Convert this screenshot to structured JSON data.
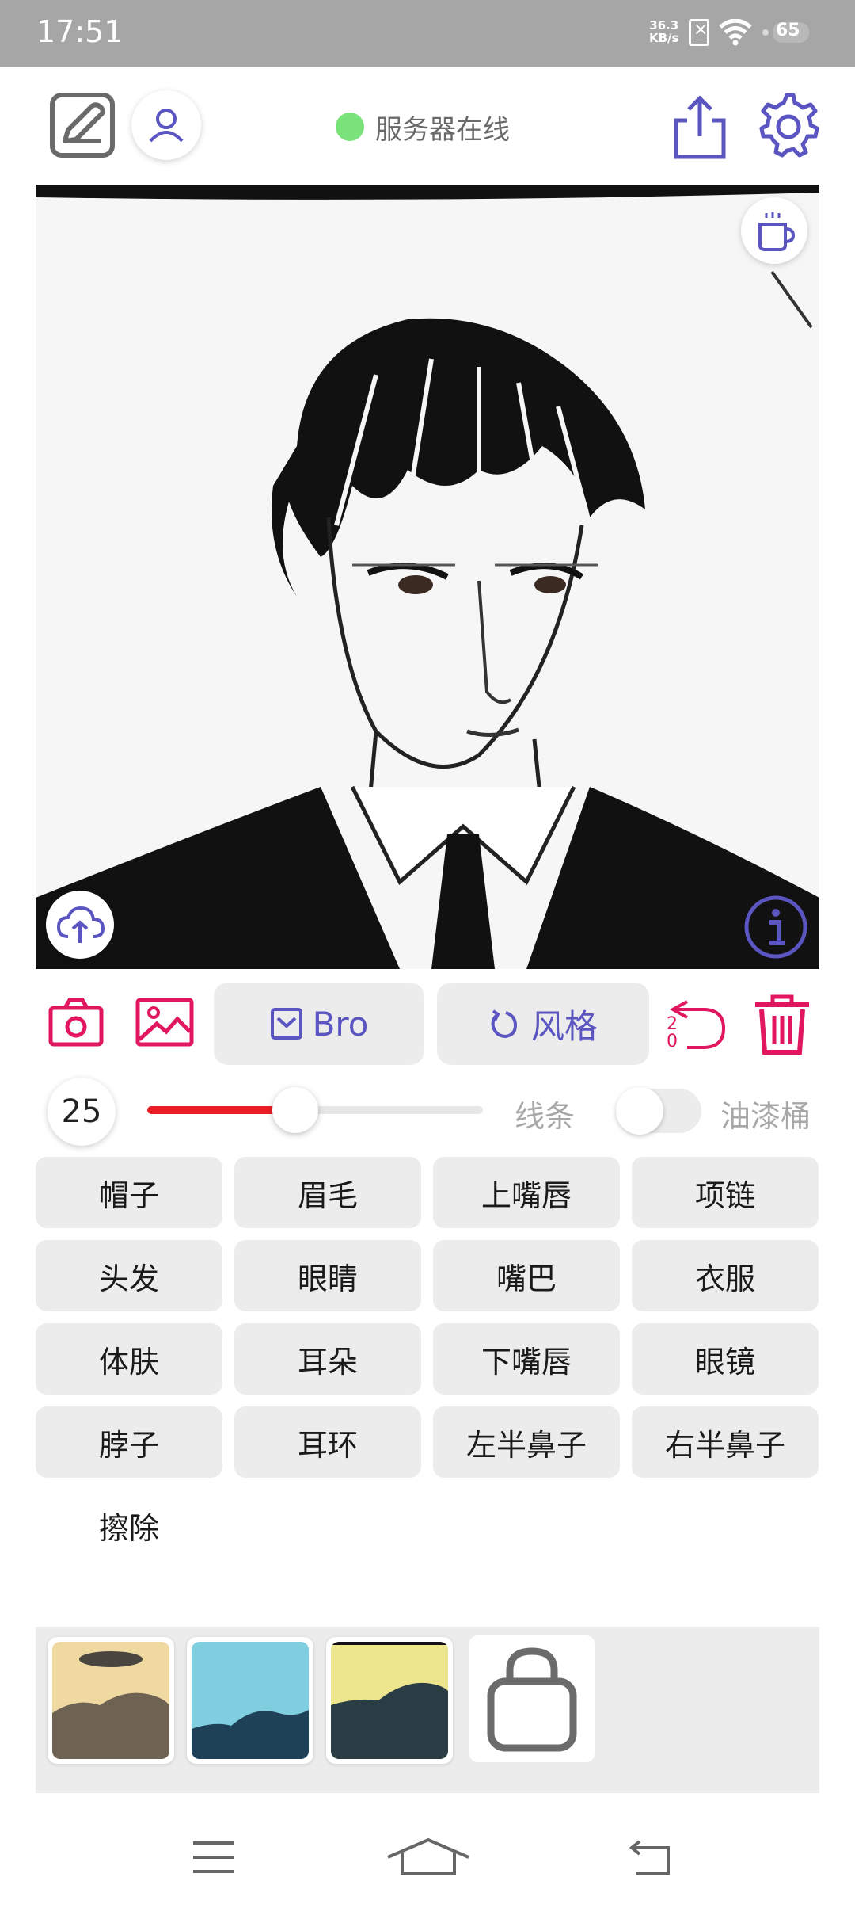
{
  "status_bar": {
    "time": "17:51",
    "net_speed_value": "36.3",
    "net_speed_unit": "KB/s",
    "battery": "65"
  },
  "header": {
    "server_status": "服务器在线",
    "server_status_color": "#79e27a"
  },
  "tools": {
    "mode_label": "Bro",
    "style_label": "风格",
    "undo_count": "20",
    "brush_size": "25",
    "brush_progress": 0.44,
    "line_label": "线条",
    "paint_bucket_label": "油漆桶",
    "paint_bucket_on": false
  },
  "parts": [
    "帽子",
    "眉毛",
    "上嘴唇",
    "项链",
    "头发",
    "眼睛",
    "嘴巴",
    "衣服",
    "体肤",
    "耳朵",
    "下嘴唇",
    "眼镜",
    "脖子",
    "耳环",
    "左半鼻子",
    "右半鼻子"
  ],
  "erase_label": "擦除",
  "colors": {
    "accent": "#5b55c2",
    "danger": "#e0165e",
    "slider": "#ec1c24"
  },
  "icons": [
    "edit-icon",
    "user-icon",
    "share-icon",
    "settings-icon",
    "coffee-icon",
    "cloud-upload-icon",
    "info-icon",
    "camera-icon",
    "image-icon",
    "undo-icon",
    "trash-icon",
    "lock-icon",
    "menu-icon",
    "home-icon",
    "back-icon"
  ]
}
